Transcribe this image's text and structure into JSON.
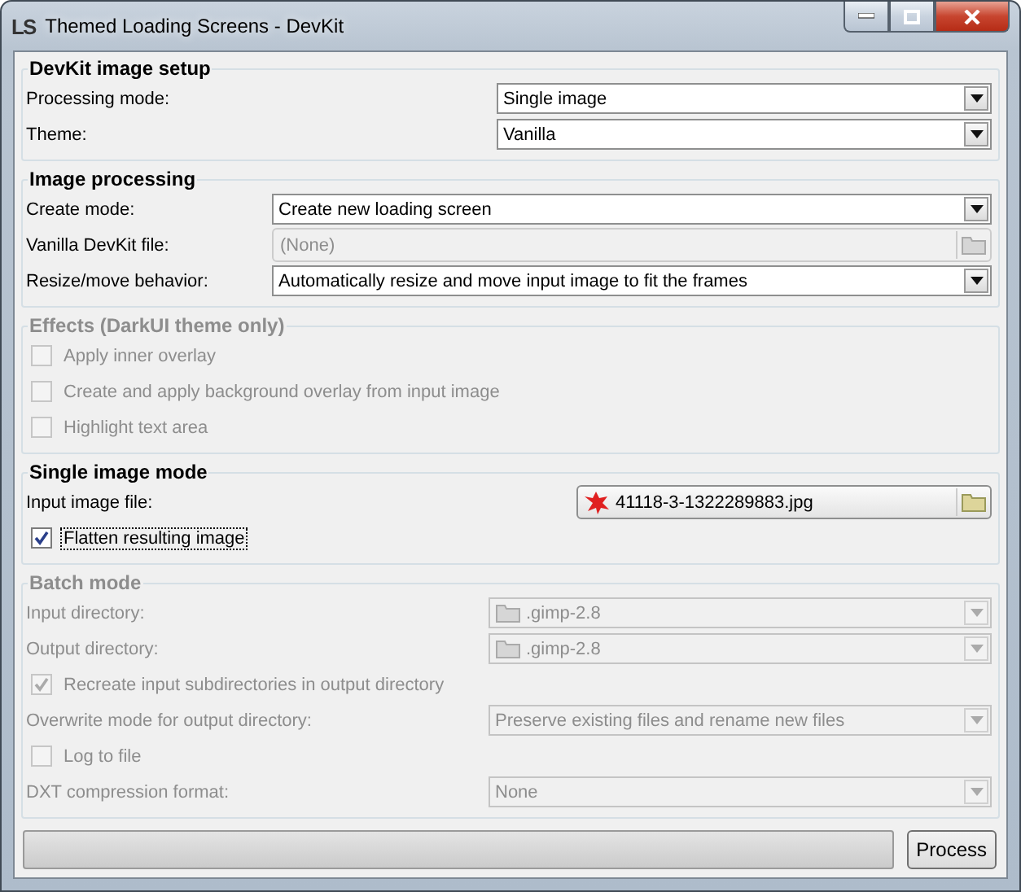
{
  "window": {
    "app_icon": "LS",
    "title": "Themed Loading Screens - DevKit"
  },
  "sections": [
    {
      "title": "DevKit image setup",
      "disabled": false,
      "rows": [
        {
          "kind": "dropdown",
          "label": "Processing mode:",
          "value": "Single image",
          "disabled": false
        },
        {
          "kind": "dropdown",
          "label": "Theme:",
          "value": "Vanilla",
          "disabled": false
        }
      ]
    },
    {
      "title": "Image processing",
      "disabled": false,
      "rows": [
        {
          "kind": "dropdown",
          "label": "Create mode:",
          "value": "Create new loading screen",
          "disabled": false
        },
        {
          "kind": "file",
          "label": "Vanilla DevKit file:",
          "value": "(None)",
          "disabled": true
        },
        {
          "kind": "dropdown",
          "label": "Resize/move behavior:",
          "value": "Automatically resize and move input image to fit the frames",
          "disabled": false
        }
      ]
    },
    {
      "title": "Effects (DarkUI theme only)",
      "disabled": true,
      "rows": [
        {
          "kind": "checkbox",
          "label": "Apply inner overlay",
          "checked": false,
          "focused": false,
          "disabled": true
        },
        {
          "kind": "checkbox",
          "label": "Create and apply background overlay from input image",
          "checked": false,
          "focused": false,
          "disabled": true
        },
        {
          "kind": "checkbox",
          "label": "Highlight text area",
          "checked": false,
          "focused": false,
          "disabled": true
        }
      ]
    },
    {
      "title": "Single image mode",
      "disabled": false,
      "rows": [
        {
          "kind": "image_file",
          "label": "Input image file:",
          "value": "41118-3-1322289883.jpg",
          "disabled": false
        },
        {
          "kind": "checkbox",
          "label": "Flatten resulting image",
          "checked": true,
          "focused": true,
          "disabled": false
        }
      ]
    },
    {
      "title": "Batch mode",
      "disabled": true,
      "rows": [
        {
          "kind": "folder_dropdown",
          "label": "Input directory:",
          "value": ".gimp-2.8",
          "disabled": true
        },
        {
          "kind": "folder_dropdown",
          "label": "Output directory:",
          "value": ".gimp-2.8",
          "disabled": true
        },
        {
          "kind": "checkbox",
          "label": "Recreate input subdirectories in output directory",
          "checked": true,
          "focused": false,
          "disabled": true
        },
        {
          "kind": "dropdown",
          "label": "Overwrite mode for output directory:",
          "value": "Preserve existing files and rename new files",
          "disabled": true
        },
        {
          "kind": "checkbox",
          "label": "Log to file",
          "checked": false,
          "focused": false,
          "disabled": true
        },
        {
          "kind": "dropdown",
          "label": "DXT compression format:",
          "value": "None",
          "disabled": true
        }
      ]
    }
  ],
  "progress": {
    "level": 0
  },
  "process_button": "Process"
}
